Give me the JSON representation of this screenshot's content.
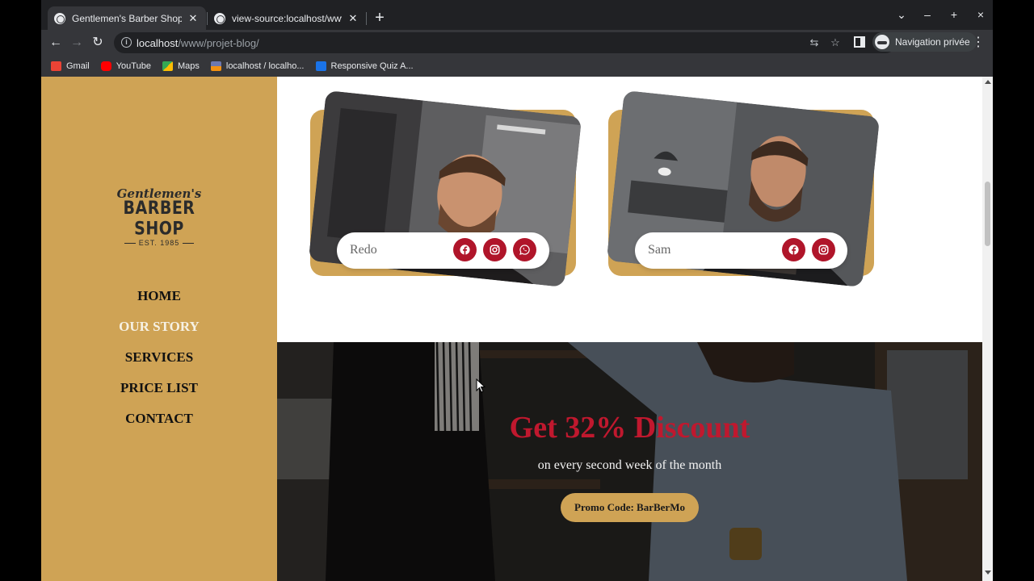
{
  "browser": {
    "tabs": [
      {
        "title": "Gentlemen's Barber Shop - HTML",
        "active": true
      },
      {
        "title": "view-source:localhost/www/projet-blog/",
        "active": false
      }
    ],
    "new_tab": "+",
    "window_controls": {
      "list": "⌄",
      "minimize": "–",
      "maximize": "+",
      "close": "×"
    },
    "toolbar": {
      "back": "←",
      "forward": "→",
      "reload": "↻"
    },
    "address": {
      "host": "localhost",
      "path": "/www/projet-blog/"
    },
    "profile_label": "Navigation privée",
    "bookmarks": [
      {
        "label": "Gmail",
        "icon": "gmail-icon",
        "color": "#ea4335"
      },
      {
        "label": "YouTube",
        "icon": "youtube-icon",
        "color": "#ff0000"
      },
      {
        "label": "Maps",
        "icon": "maps-icon",
        "color": "#34a853"
      },
      {
        "label": "localhost / localho...",
        "icon": "phpmyadmin-icon",
        "color": "#f29111"
      },
      {
        "label": "Responsive Quiz A...",
        "icon": "stackoverflow-icon",
        "color": "#1a73e8"
      }
    ]
  },
  "site": {
    "logo": {
      "script": "Gentlemen's",
      "main": "BARBER SHOP",
      "est": "EST. 1985"
    },
    "nav": [
      {
        "label": "HOME",
        "current": false
      },
      {
        "label": "OUR STORY",
        "current": true
      },
      {
        "label": "SERVICES",
        "current": false
      },
      {
        "label": "PRICE LIST",
        "current": false
      },
      {
        "label": "CONTACT",
        "current": false
      }
    ],
    "team": [
      {
        "name": "Redo",
        "socials": [
          "facebook-icon",
          "instagram-icon",
          "whatsapp-icon"
        ]
      },
      {
        "name": "Sam",
        "socials": [
          "facebook-icon",
          "instagram-icon"
        ]
      }
    ],
    "promo": {
      "title": "Get 32% Discount",
      "subtitle": "on every second week of the month",
      "code_label": "Promo Code: BarBerMo"
    },
    "colors": {
      "gold": "#cfa355",
      "accent_red": "#b0152a",
      "promo_red": "#c0182e"
    }
  }
}
